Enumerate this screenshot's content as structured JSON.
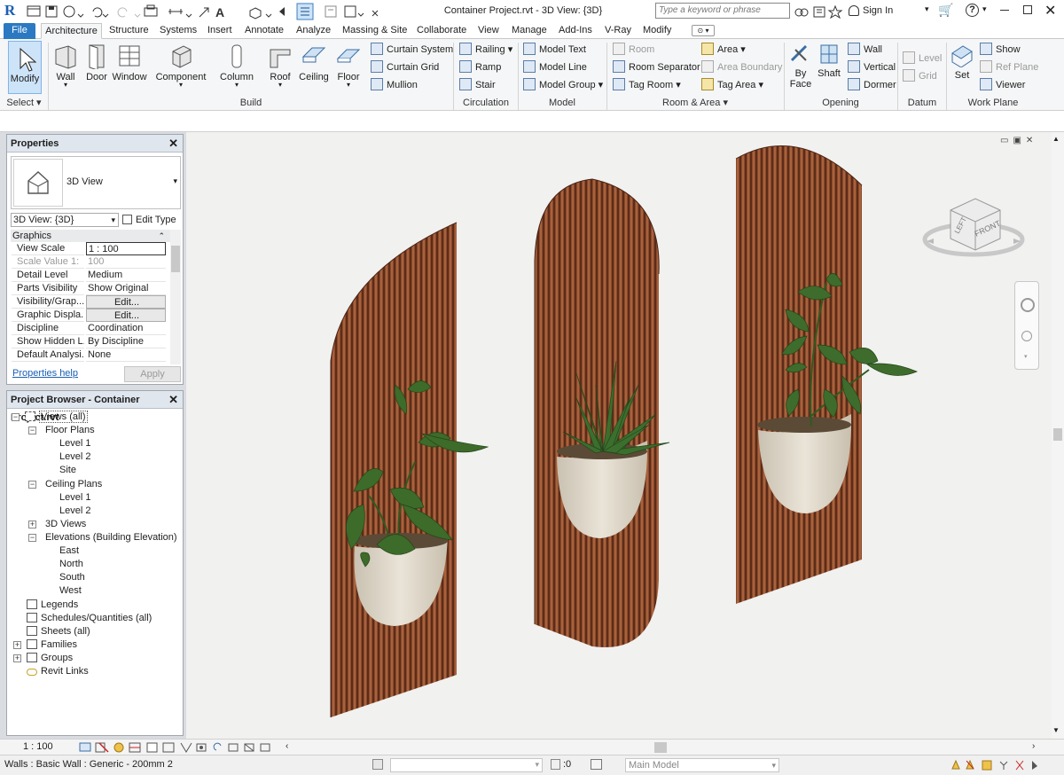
{
  "app": {
    "title": "Container Project.rvt - 3D View: {3D}",
    "search_placeholder": "Type a keyword or phrase",
    "sign_in": "Sign In"
  },
  "tabs": [
    "File",
    "Architecture",
    "Structure",
    "Systems",
    "Insert",
    "Annotate",
    "Analyze",
    "Massing & Site",
    "Collaborate",
    "View",
    "Manage",
    "Add-Ins",
    "V-Ray",
    "Modify"
  ],
  "ribbon": {
    "select": {
      "modify": "Modify",
      "panel": "Select"
    },
    "build": {
      "panel": "Build",
      "wall": "Wall",
      "door": "Door",
      "window": "Window",
      "component": "Component",
      "column": "Column",
      "roof": "Roof",
      "ceiling": "Ceiling",
      "floor": "Floor",
      "curtain_system": "Curtain System",
      "curtain_grid": "Curtain Grid",
      "mullion": "Mullion"
    },
    "circulation": {
      "panel": "Circulation",
      "railing": "Railing",
      "ramp": "Ramp",
      "stair": "Stair"
    },
    "model": {
      "panel": "Model",
      "model_text": "Model  Text",
      "model_line": "Model  Line",
      "model_group": "Model  Group"
    },
    "room_area": {
      "panel": "Room & Area",
      "room": "Room",
      "room_separator": "Room  Separator",
      "tag_room": "Tag  Room",
      "area": "Area",
      "area_boundary": "Area  Boundary",
      "tag_area": "Tag  Area"
    },
    "opening": {
      "panel": "Opening",
      "by_face_1": "By",
      "by_face_2": "Face",
      "shaft": "Shaft",
      "wall": "Wall",
      "vertical": "Vertical",
      "dormer": "Dormer"
    },
    "datum": {
      "panel": "Datum",
      "level": "Level",
      "grid": "Grid"
    },
    "work_plane": {
      "panel": "Work Plane",
      "set": "Set",
      "show": "Show",
      "ref_plane": "Ref  Plane",
      "viewer": "Viewer"
    }
  },
  "properties": {
    "title": "Properties",
    "type_name": "3D View",
    "instance_selector": "3D View: {3D}",
    "edit_type": "Edit Type",
    "section": "Graphics",
    "rows": [
      {
        "label": "View Scale",
        "value": "1 : 100"
      },
      {
        "label": "Scale Value    1:",
        "value": "100"
      },
      {
        "label": "Detail Level",
        "value": "Medium"
      },
      {
        "label": "Parts Visibility",
        "value": "Show Original"
      },
      {
        "label": "Visibility/Grap...",
        "value": "Edit..."
      },
      {
        "label": "Graphic Displa...",
        "value": "Edit..."
      },
      {
        "label": "Discipline",
        "value": "Coordination"
      },
      {
        "label": "Show Hidden L...",
        "value": "By Discipline"
      },
      {
        "label": "Default Analysi...",
        "value": "None"
      }
    ],
    "help_link": "Properties help",
    "apply": "Apply"
  },
  "project_browser": {
    "title": "Project Browser - Container Project.rvt",
    "items": [
      {
        "label": "Views (all)"
      },
      {
        "label": "Floor Plans"
      },
      {
        "label": "Level 1"
      },
      {
        "label": "Level 2"
      },
      {
        "label": "Site"
      },
      {
        "label": "Ceiling Plans"
      },
      {
        "label": "Level 1"
      },
      {
        "label": "Level 2"
      },
      {
        "label": "3D Views"
      },
      {
        "label": "Elevations (Building Elevation)"
      },
      {
        "label": "East"
      },
      {
        "label": "North"
      },
      {
        "label": "South"
      },
      {
        "label": "West"
      },
      {
        "label": "Legends"
      },
      {
        "label": "Schedules/Quantities (all)"
      },
      {
        "label": "Sheets (all)"
      },
      {
        "label": "Families"
      },
      {
        "label": "Groups"
      },
      {
        "label": "Revit Links"
      }
    ]
  },
  "view": {
    "scale": "1 : 100",
    "viewcube_left": "LEFT",
    "viewcube_front": "FRONT"
  },
  "status": {
    "selection": "Walls : Basic Wall : Generic - 200mm 2",
    "worksets": ":0",
    "model": "Main Model"
  },
  "colors": {
    "file_tab": "#2b79c2",
    "wood": "#8a4a2c",
    "pot": "#ddd6c7",
    "leaf": "#3d6b2a",
    "canvas": "#f1f1f0"
  }
}
